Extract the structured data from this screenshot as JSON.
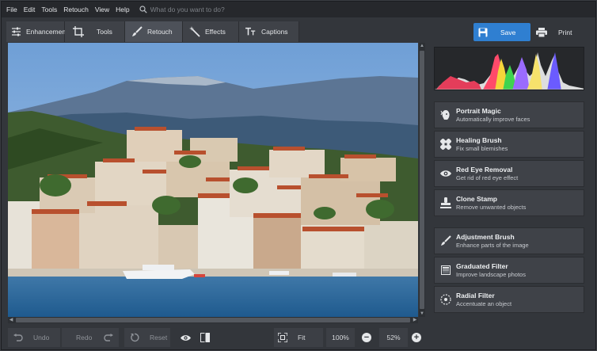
{
  "menu": {
    "items": [
      "File",
      "Edit",
      "Tools",
      "Retouch",
      "View",
      "Help"
    ],
    "search_placeholder": "What do you want to do?"
  },
  "tabs": [
    {
      "label": "Enhancement",
      "icon": "sliders-icon",
      "active": false
    },
    {
      "label": "Tools",
      "icon": "crop-icon",
      "active": false
    },
    {
      "label": "Retouch",
      "icon": "brush-icon",
      "active": true
    },
    {
      "label": "Effects",
      "icon": "magic-wand-icon",
      "active": false
    },
    {
      "label": "Captions",
      "icon": "text-icon",
      "active": false
    }
  ],
  "actions": {
    "save_label": "Save",
    "print_label": "Print",
    "accent_color": "#2f7fd1"
  },
  "tools_group1": [
    {
      "title": "Portrait Magic",
      "subtitle": "Automatically improve faces",
      "icon": "face-magic-icon"
    },
    {
      "title": "Healing Brush",
      "subtitle": "Fix small blemishes",
      "icon": "bandage-icon"
    },
    {
      "title": "Red Eye Removal",
      "subtitle": "Get rid of red eye effect",
      "icon": "eye-icon"
    },
    {
      "title": "Clone Stamp",
      "subtitle": "Remove unwanted objects",
      "icon": "stamp-icon"
    }
  ],
  "tools_group2": [
    {
      "title": "Adjustment Brush",
      "subtitle": "Enhance parts of the image",
      "icon": "brush-icon"
    },
    {
      "title": "Graduated Filter",
      "subtitle": "Improve landscape photos",
      "icon": "gradient-icon"
    },
    {
      "title": "Radial Filter",
      "subtitle": "Accentuate an object",
      "icon": "radial-icon"
    }
  ],
  "bottom": {
    "undo_label": "Undo",
    "redo_label": "Redo",
    "reset_label": "Reset",
    "fit_label": "Fit",
    "zoom_100_label": "100%",
    "zoom_current": "52%"
  }
}
